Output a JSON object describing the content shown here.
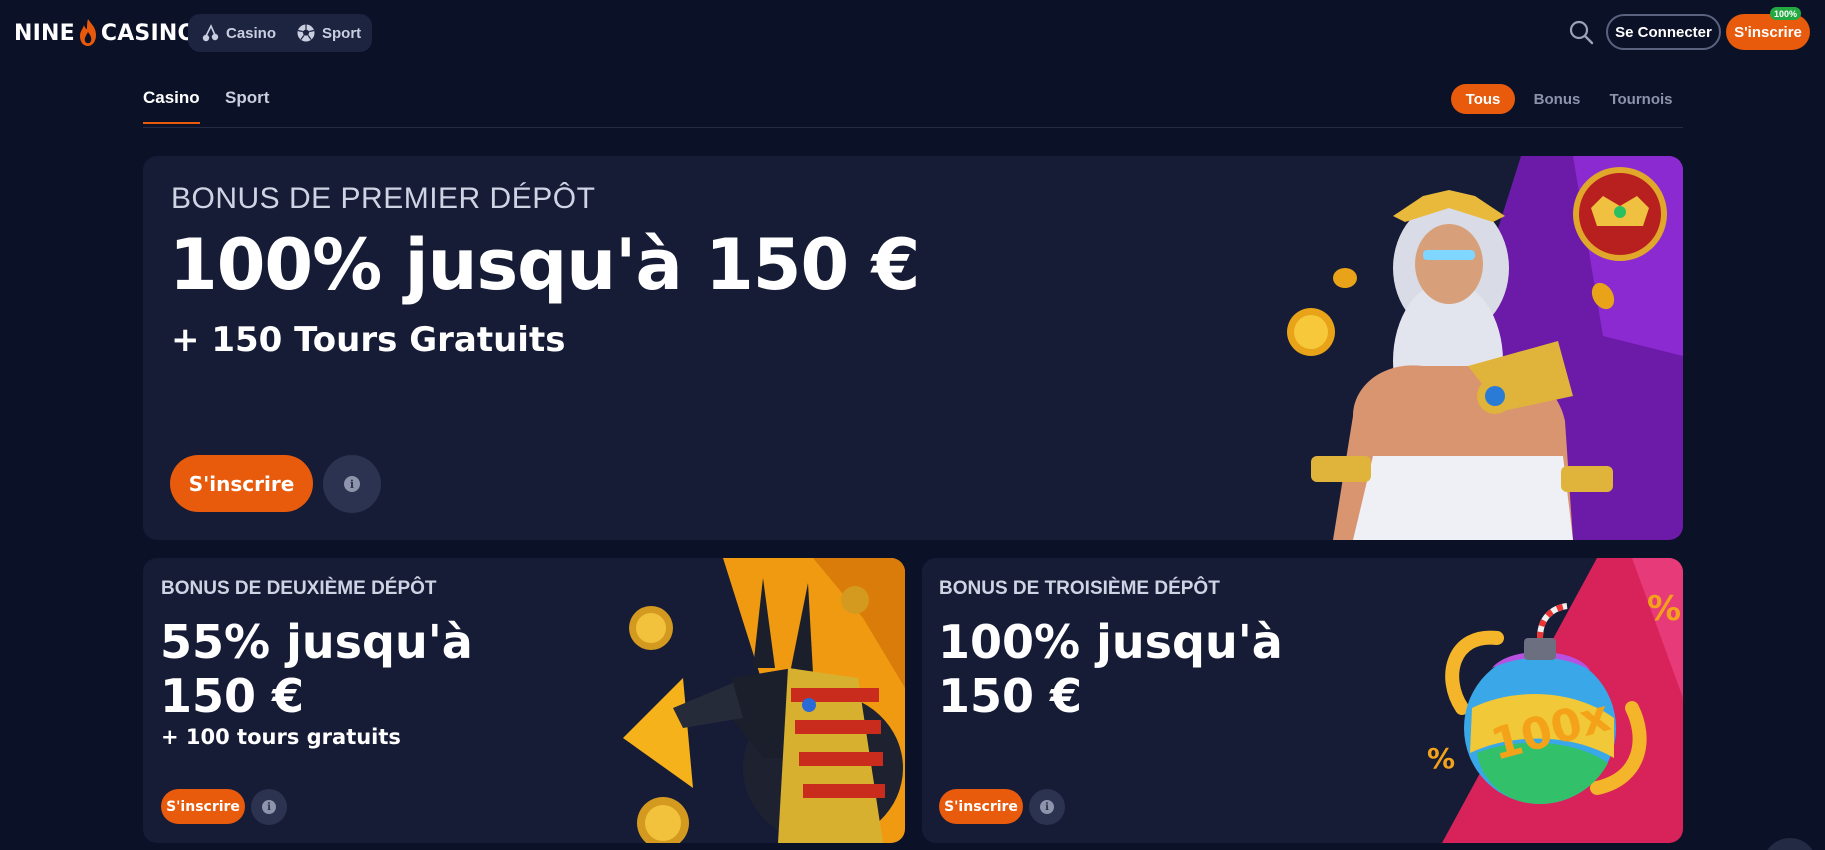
{
  "header": {
    "logo_left": "NINE",
    "logo_right": "CASINO",
    "toggle": [
      {
        "label": "Casino",
        "icon": "cherries-icon"
      },
      {
        "label": "Sport",
        "icon": "soccer-ball-icon"
      }
    ],
    "search_icon": "search-icon",
    "login_label": "Se Connecter",
    "signup_label": "S'inscrire",
    "signup_badge": "100%"
  },
  "subnav": {
    "tabs": [
      {
        "label": "Casino",
        "active": true
      },
      {
        "label": "Sport",
        "active": false
      }
    ],
    "filters": [
      {
        "label": "Tous",
        "active": true
      },
      {
        "label": "Bonus",
        "active": false
      },
      {
        "label": "Tournois",
        "active": false
      }
    ]
  },
  "promos": {
    "first": {
      "eyebrow": "BONUS DE PREMIER DÉPÔT",
      "headline": "100% jusqu'à 150 €",
      "sub": "+ 150 Tours Gratuits",
      "cta": "S'inscrire"
    },
    "second": {
      "eyebrow": "BONUS DE DEUXIÈME DÉPÔT",
      "headline_line1": "55% jusqu'à",
      "headline_line2": "150 €",
      "sub": "+ 100 tours gratuits",
      "cta": "S'inscrire"
    },
    "third": {
      "eyebrow": "BONUS DE TROISIÈME DÉPÔT",
      "headline_line1": "100% jusqu'à",
      "headline_line2": "150 €",
      "cta": "S'inscrire",
      "art_text": "100x"
    }
  },
  "colors": {
    "background": "#0b1127",
    "card": "#161c36",
    "accent": "#e85a0c",
    "badge": "#23a942"
  }
}
